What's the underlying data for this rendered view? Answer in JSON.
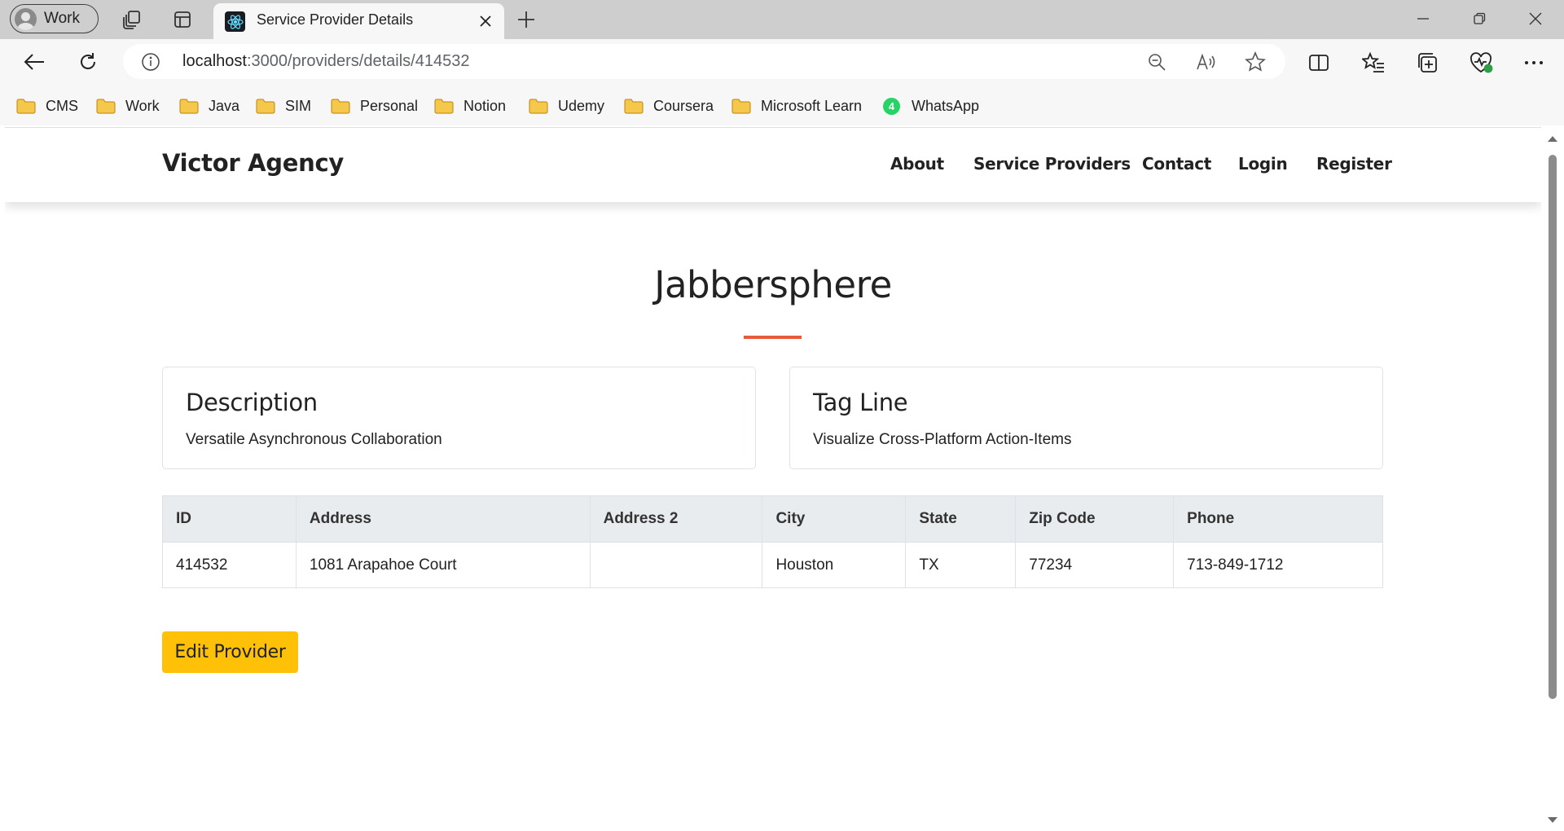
{
  "browser": {
    "profile_label": "Work",
    "tab_title": "Service Provider Details",
    "url_host": "localhost",
    "url_path": ":3000/providers/details/414532",
    "favorites": [
      {
        "label": "CMS",
        "icon": "folder-icon"
      },
      {
        "label": "Work",
        "icon": "folder-icon"
      },
      {
        "label": "Java",
        "icon": "folder-icon"
      },
      {
        "label": "SIM",
        "icon": "folder-icon"
      },
      {
        "label": "Personal",
        "icon": "folder-icon"
      },
      {
        "label": "Notion",
        "icon": "folder-icon"
      },
      {
        "label": "Udemy",
        "icon": "folder-icon"
      },
      {
        "label": "Coursera",
        "icon": "folder-icon"
      },
      {
        "label": "Microsoft Learn",
        "icon": "folder-icon"
      },
      {
        "label": "WhatsApp",
        "icon": "whatsapp-icon"
      }
    ],
    "whatsapp_badge": "4"
  },
  "site": {
    "brand": "Victor Agency",
    "nav": [
      "About",
      "Service Providers",
      "Contact",
      "Login",
      "Register"
    ]
  },
  "provider": {
    "name": "Jabbersphere",
    "description_title": "Description",
    "description": "Versatile Asynchronous Collaboration",
    "tagline_title": "Tag Line",
    "tagline": "Visualize Cross-Platform Action-Items"
  },
  "table": {
    "headers": [
      "ID",
      "Address",
      "Address 2",
      "City",
      "State",
      "Zip Code",
      "Phone"
    ],
    "row": [
      "414532",
      "1081 Arapahoe Court",
      "",
      "Houston",
      "TX",
      "77234",
      "713-849-1712"
    ]
  },
  "actions": {
    "edit_label": "Edit Provider"
  },
  "colors": {
    "accent_underline": "#e85b3a",
    "edit_button": "#ffc107",
    "folder": "#f5c84c"
  }
}
